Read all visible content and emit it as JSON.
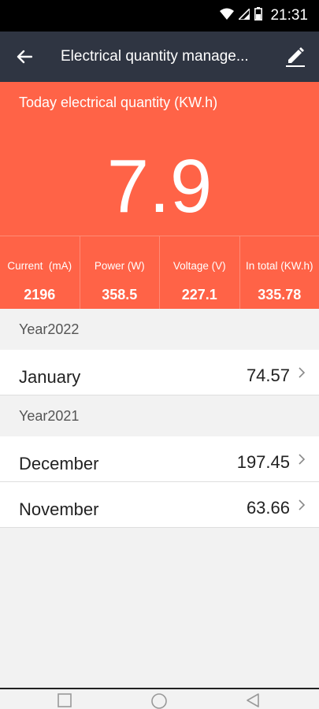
{
  "status_bar": {
    "time": "21:31",
    "icons": [
      "wifi-icon",
      "signal-icon",
      "battery-icon"
    ]
  },
  "app_bar": {
    "title": "Electrical quantity manage...",
    "back_icon": "arrow-left-icon",
    "edit_icon": "pencil-icon"
  },
  "hero": {
    "label": "Today electrical quantity (KW.h)",
    "value": "7.9"
  },
  "stats": [
    {
      "label": "Current  (mA)",
      "value": "2196"
    },
    {
      "label": "Power (W)",
      "value": "358.5"
    },
    {
      "label": "Voltage (V)",
      "value": "227.1"
    },
    {
      "label": "In total (KW.h)",
      "value": "335.78"
    }
  ],
  "groups": [
    {
      "year": "Year2022",
      "months": [
        {
          "name": "January",
          "value": "74.57"
        }
      ]
    },
    {
      "year": "Year2021",
      "months": [
        {
          "name": "December",
          "value": "197.45"
        },
        {
          "name": "November",
          "value": "63.66"
        }
      ]
    }
  ],
  "nav_bar": {
    "icons": [
      "recents-square-icon",
      "home-circle-icon",
      "back-triangle-icon"
    ]
  },
  "colors": {
    "accent": "#ff6347",
    "app_bar": "#2f3542",
    "background": "#f2f2f2"
  }
}
